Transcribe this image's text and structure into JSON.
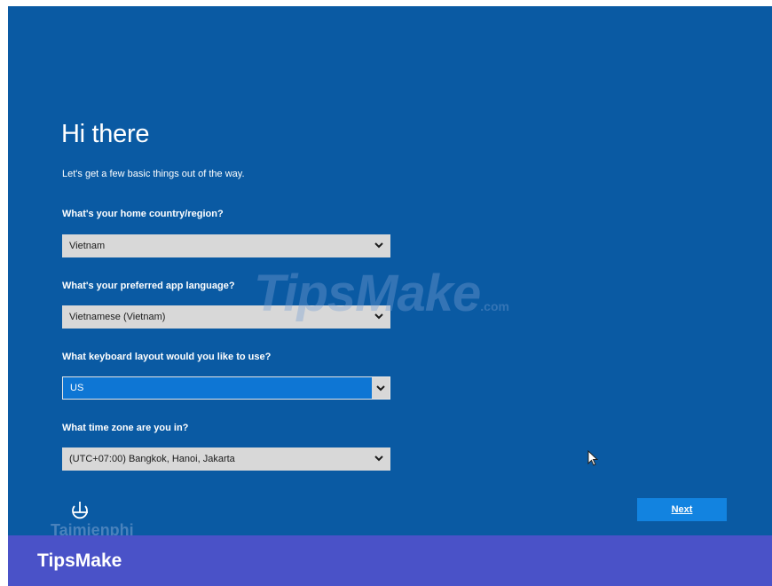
{
  "setup": {
    "title": "Hi there",
    "subtitle": "Let's get a few basic things out of the way.",
    "country_label": "What's your home country/region?",
    "country_value": "Vietnam",
    "language_label": "What's your preferred app language?",
    "language_value": "Vietnamese (Vietnam)",
    "keyboard_label": "What keyboard layout would you like to use?",
    "keyboard_value": "US",
    "timezone_label": "What time zone are you in?",
    "timezone_value": "(UTC+07:00) Bangkok, Hanoi, Jakarta",
    "next_label": "Next"
  },
  "watermarks": {
    "center": "TipsMake",
    "center_suffix": ".com",
    "lower_left": "Taimienphi"
  },
  "branding": {
    "footer_text": "TipsMake"
  },
  "colors": {
    "background": "#0a5aa3",
    "focused_select": "#0e76d4",
    "next_button": "#1283e0",
    "brand_bar": "#4a52c8"
  },
  "icons": {
    "accessibility": "ease-of-access-icon",
    "dropdown": "chevron-down-icon",
    "pointer": "mouse-cursor-icon"
  }
}
